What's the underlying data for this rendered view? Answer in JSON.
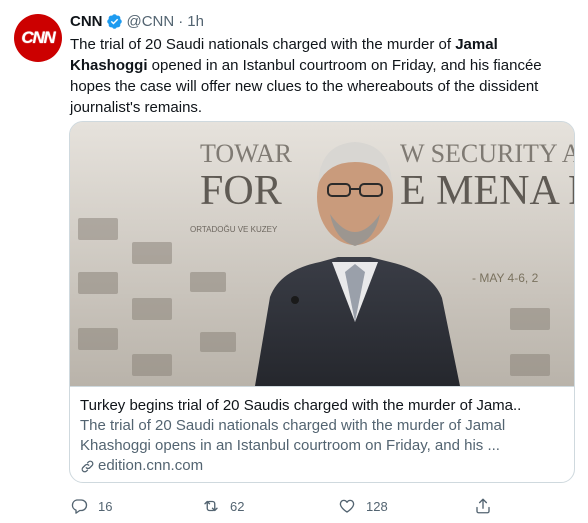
{
  "tweet": {
    "author_name": "CNN",
    "avatar_text": "CNN",
    "handle": "@CNN",
    "separator": "·",
    "time": "1h",
    "text_part1": "The trial of 20 Saudi nationals charged with the murder of ",
    "text_bold": "Jamal Khashoggi",
    "text_part2": " opened in an Istanbul courtroom on Friday, and his fiancée hopes the case will offer new clues to the whereabouts of the dissident journalist's remains."
  },
  "card": {
    "title": "Turkey begins trial of 20 Saudis charged with the murder of Jama..",
    "description": "The trial of 20 Saudi nationals charged with the murder of Jamal Khashoggi opens in an Istanbul courtroom on Friday, and his ...",
    "domain": "edition.cnn.com",
    "banner_line1": "TOWAR",
    "banner_line1b": "W SECURITY ARR",
    "banner_line2a": "FOR",
    "banner_line2b": "E MENA R",
    "banner_small": "ORTADOĞU VE KUZEY",
    "banner_date": "- MAY 4-6, 2"
  },
  "actions": {
    "replies": "16",
    "retweets": "62",
    "likes": "128"
  },
  "colors": {
    "brand_red": "#cc0000",
    "verified_blue": "#1d9bf0",
    "muted_text": "#536471"
  }
}
